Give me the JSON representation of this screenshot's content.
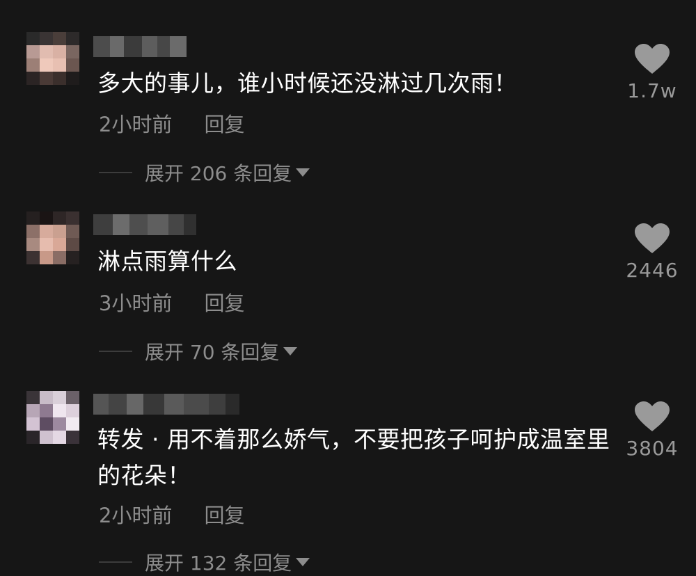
{
  "comments": [
    {
      "text": "多大的事儿，谁小时候还没淋过几次雨！",
      "time": "2小时前",
      "reply_label": "回复",
      "expand_label": "展开 206 条回复",
      "likes": "1.7w",
      "icon": "heart-icon"
    },
    {
      "text": "淋点雨算什么",
      "time": "3小时前",
      "reply_label": "回复",
      "expand_label": "展开 70 条回复",
      "likes": "2446",
      "icon": "heart-icon"
    },
    {
      "text": "转发 · 用不着那么娇气，不要把孩子呵护成温室里的花朵！",
      "time": "2小时前",
      "reply_label": "回复",
      "expand_label": "展开 132 条回复",
      "likes": "3804",
      "icon": "heart-icon"
    }
  ],
  "colors": {
    "background": "#161616",
    "secondary_text": "#8d8d8d",
    "heart": "#9a9a9a"
  }
}
